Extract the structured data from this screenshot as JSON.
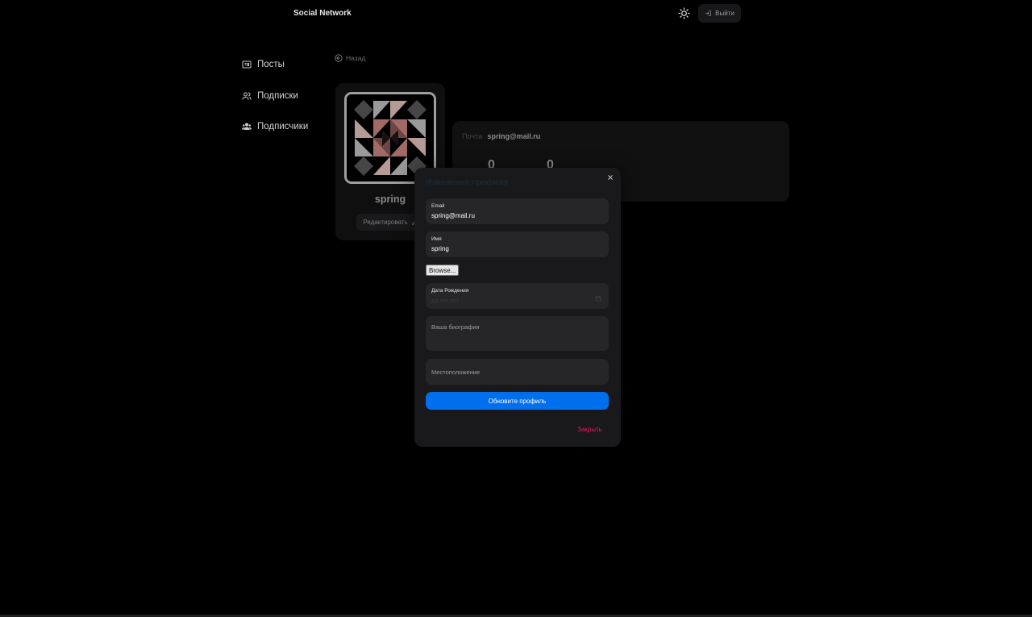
{
  "header": {
    "brand": "Social Network",
    "logout_label": "Выйти"
  },
  "sidebar": {
    "items": [
      {
        "label": "Посты",
        "icon": "posts-icon"
      },
      {
        "label": "Подписки",
        "icon": "following-icon"
      },
      {
        "label": "Подписчики",
        "icon": "followers-icon"
      }
    ]
  },
  "back_label": "Назад",
  "profile": {
    "name": "spring",
    "edit_label": "Редактировать"
  },
  "info": {
    "email_label": "Почта",
    "email_value": "spring@mail.ru",
    "stats": [
      "0",
      "0"
    ]
  },
  "modal": {
    "title": "Изменение профиля",
    "fields": {
      "email_label": "Email",
      "email_value": "spring@mail.ru",
      "name_label": "Имя",
      "name_value": "spring",
      "browse_label": "Browse...",
      "birthdate_label": "Дата Рождения",
      "birthdate_placeholder": "дд.мм.гггг",
      "bio_placeholder": "Ваша биография",
      "location_placeholder": "Местоположение"
    },
    "submit_label": "Обновите профиль",
    "close_label": "Закрыть"
  },
  "colors": {
    "accent_blue": "#006fee",
    "danger": "#f31260",
    "background": "#000000",
    "modal_bg": "#19191b",
    "field_bg": "#262628"
  }
}
